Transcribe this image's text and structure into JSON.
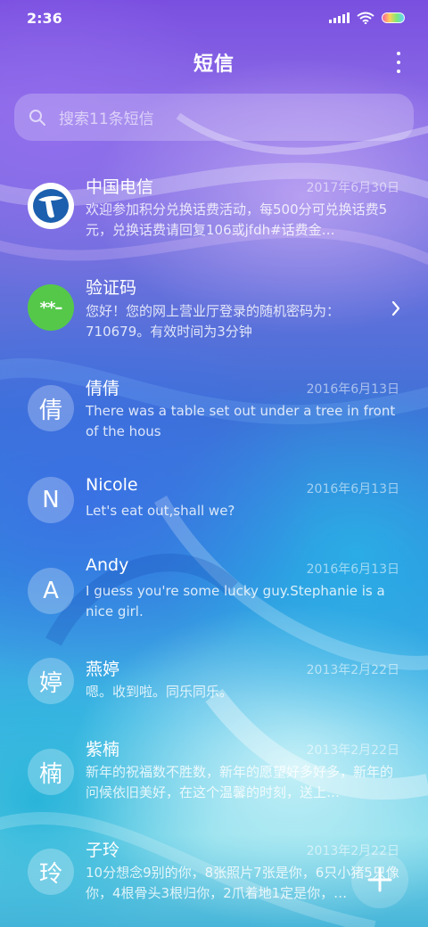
{
  "status_bar": {
    "time": "2:36"
  },
  "header": {
    "title": "短信",
    "more_icon": "more-vertical-icon"
  },
  "search": {
    "placeholder": "搜索11条短信",
    "icon": "search-icon"
  },
  "messages": [
    {
      "sender": "中国电信",
      "date": "2017年6月30日",
      "preview": "欢迎参加积分兑换话费活动，每500分可兑换话费5元，兑换话费请回复106或jfdh#话费金…",
      "avatar_icon": "china-telecom-logo-icon"
    },
    {
      "sender": "验证码",
      "date": "",
      "preview": "您好！您的网上营业厅登录的随机密码为：710679。有效时间为3分钟",
      "avatar_text": "**–",
      "trailing_icon": "chevron-right-icon"
    },
    {
      "sender": "倩倩",
      "date": "2016年6月13日",
      "preview": "There was a table set out under a tree in front of the hous",
      "avatar_text": "倩"
    },
    {
      "sender": "Nicole",
      "date": "2016年6月13日",
      "preview": "Let's eat out,shall we?",
      "avatar_text": "N"
    },
    {
      "sender": "Andy",
      "date": "2016年6月13日",
      "preview": "I guess you're some lucky guy.Stephanie is a nice girl.",
      "avatar_text": "A"
    },
    {
      "sender": "燕婷",
      "date": "2013年2月22日",
      "preview": "嗯。收到啦。同乐同乐。",
      "avatar_text": "婷"
    },
    {
      "sender": "紫楠",
      "date": "2013年2月22日",
      "preview": "新年的祝福数不胜数，新年的愿望好多好多，新年的问候依旧美好，在这个温馨的时刻，送上…",
      "avatar_text": "楠"
    },
    {
      "sender": "子玲",
      "date": "2013年2月22日",
      "preview": "10分想念9别的你，8张照片7张是你，6只小猪5只像你，4根骨头3根归你，2爪着地1定是你，…",
      "avatar_text": "玲"
    }
  ],
  "fab": {
    "icon": "plus-icon"
  },
  "colors": {
    "avatar_green": "#55c84a",
    "telecom_blue": "#1c5fae"
  }
}
